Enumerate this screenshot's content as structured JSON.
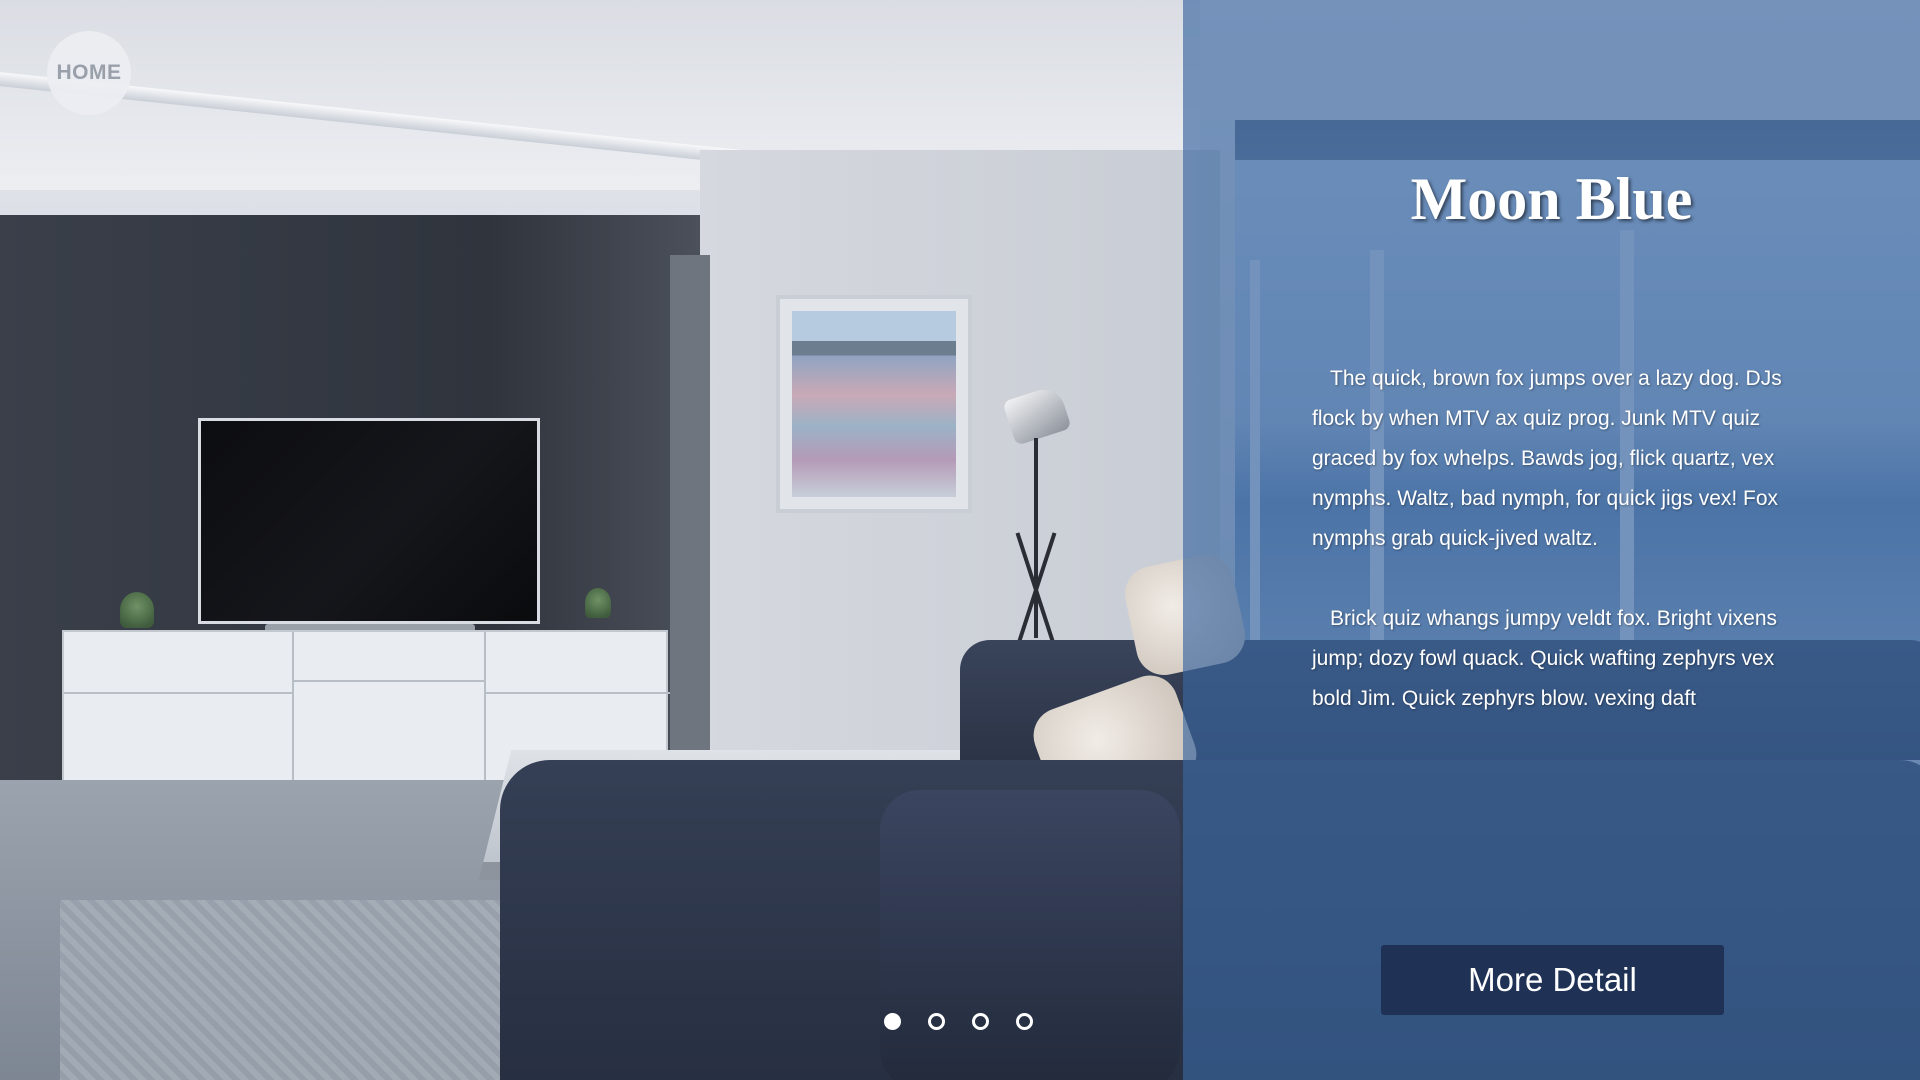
{
  "home": {
    "label": "HOME"
  },
  "hero": {
    "title": "Moon Blue",
    "paragraphs": [
      "The quick, brown fox jumps over a lazy dog. DJs flock by when MTV ax quiz prog. Junk MTV quiz graced by fox whelps. Bawds jog, flick quartz, vex nymphs. Waltz, bad nymph, for quick jigs vex! Fox nymphs grab quick-jived waltz.",
      "Brick quiz whangs jumpy veldt fox. Bright vixens jump; dozy fowl quack. Quick wafting zephyrs vex bold Jim. Quick zephyrs blow. vexing daft"
    ],
    "button_label": "More Detail"
  },
  "carousel": {
    "count": 4,
    "active_index": 0
  },
  "colors": {
    "panel_overlay": "#3a66a0",
    "button_bg": "#1f3256",
    "text": "#ffffff"
  }
}
